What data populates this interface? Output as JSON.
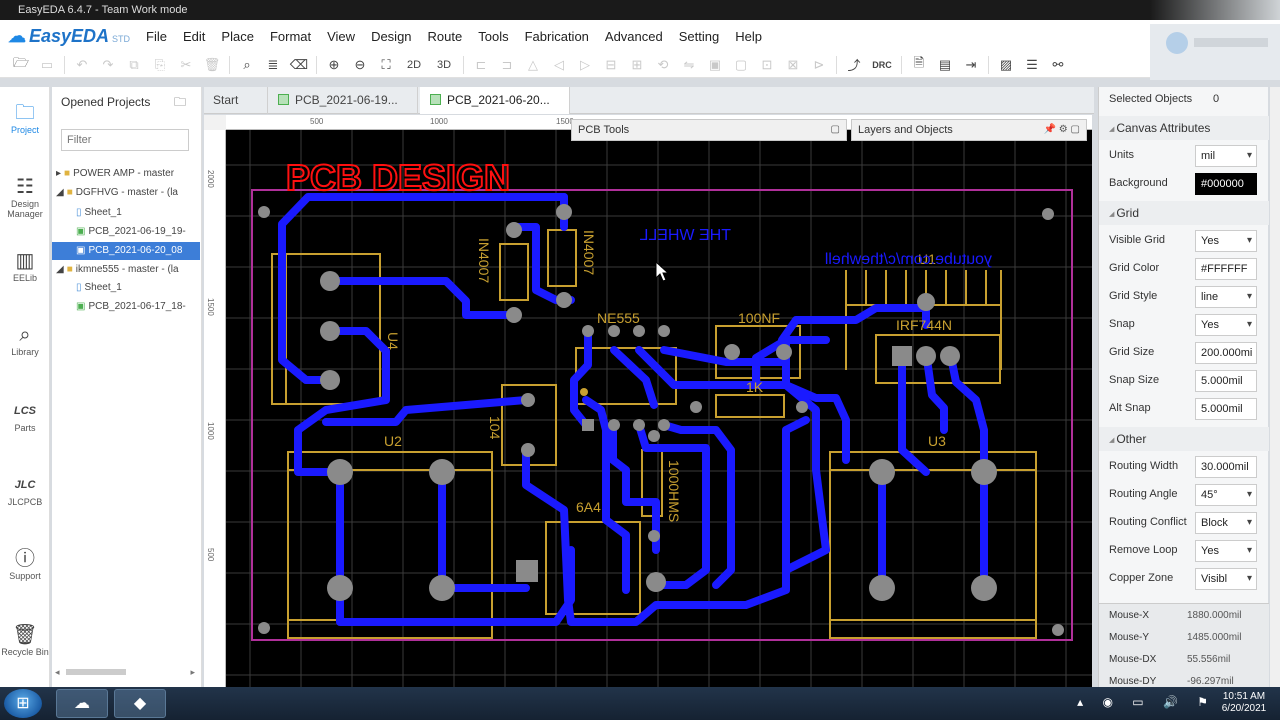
{
  "window": {
    "title": "EasyEDA 6.4.7 - Team Work mode"
  },
  "app": {
    "logo": "EasyEDA",
    "edition": "STD"
  },
  "menu": [
    "File",
    "Edit",
    "Place",
    "Format",
    "View",
    "Design",
    "Route",
    "Tools",
    "Fabrication",
    "Advanced",
    "Setting",
    "Help"
  ],
  "toolbar": {
    "view2d": "2D",
    "view3d": "3D",
    "drc": "DRC"
  },
  "leftbar": [
    {
      "label": "Project",
      "icon": "folder-icon"
    },
    {
      "label": "Design Manager",
      "icon": "list-icon"
    },
    {
      "label": "EELib",
      "icon": "chip-icon"
    },
    {
      "label": "Library",
      "icon": "search-library-icon"
    },
    {
      "label": "Parts",
      "icon": "lcsc-icon"
    },
    {
      "label": "JLCPCB",
      "icon": "jlc-icon"
    },
    {
      "label": "Support",
      "icon": "help-icon"
    },
    {
      "label": "Recycle Bin",
      "icon": "trash-icon"
    }
  ],
  "projects": {
    "title": "Opened Projects",
    "filter_placeholder": "Filter",
    "items": [
      {
        "label": "POWER AMP - master",
        "type": "folder",
        "indent": 0
      },
      {
        "label": "DGFHVG - master - (la",
        "type": "folder",
        "indent": 0
      },
      {
        "label": "Sheet_1",
        "type": "sheet",
        "indent": 1
      },
      {
        "label": "PCB_2021-06-19_19-",
        "type": "pcb",
        "indent": 1
      },
      {
        "label": "PCB_2021-06-20_08",
        "type": "pcb",
        "indent": 1,
        "selected": true
      },
      {
        "label": "ikmne555 - master - (la",
        "type": "folder",
        "indent": 0
      },
      {
        "label": "Sheet_1",
        "type": "sheet",
        "indent": 1
      },
      {
        "label": "PCB_2021-06-17_18-",
        "type": "pcb",
        "indent": 1
      }
    ]
  },
  "tabs": [
    {
      "label": "Start"
    },
    {
      "label": "PCB_2021-06-19..."
    },
    {
      "label": "PCB_2021-06-20..."
    }
  ],
  "rulers": {
    "top": [
      "500",
      "1000",
      "1500"
    ],
    "left": [
      "2000",
      "1500",
      "1000",
      "500"
    ]
  },
  "floating": {
    "pcb_tools": "PCB Tools",
    "layers": "Layers and Objects"
  },
  "board": {
    "title": "PCB DESIGN",
    "labels": {
      "in4007a": "IN4007",
      "in4007b": "IN4007",
      "thewheel": "THE WHELL",
      "youtube": "youtube.com/c/thewhell",
      "u1": "U1",
      "ne555": "NE555",
      "c100nf": "100NF",
      "irf": "IRF744N",
      "r1k": "1K",
      "u4": "U4",
      "c104": "104",
      "u2": "U2",
      "u3": "U3",
      "f6a4": "6A4",
      "smd": "1000HMS"
    }
  },
  "properties": {
    "selected_label": "Selected Objects",
    "selected_count": "0",
    "sections": {
      "canvas": "Canvas Attributes",
      "grid": "Grid",
      "other": "Other"
    },
    "canvas": [
      {
        "label": "Units",
        "value": "mil",
        "select": true
      },
      {
        "label": "Background",
        "value": "#000000",
        "select": false
      }
    ],
    "grid": [
      {
        "label": "Visible Grid",
        "value": "Yes",
        "select": true
      },
      {
        "label": "Grid Color",
        "value": "#FFFFFF",
        "select": false
      },
      {
        "label": "Grid Style",
        "value": "line",
        "select": true
      },
      {
        "label": "Snap",
        "value": "Yes",
        "select": true
      },
      {
        "label": "Grid Size",
        "value": "200.000mi",
        "select": false
      },
      {
        "label": "Snap Size",
        "value": "5.000mil",
        "select": false
      },
      {
        "label": "Alt Snap",
        "value": "5.000mil",
        "select": false
      }
    ],
    "other": [
      {
        "label": "Routing Width",
        "value": "30.000mil",
        "select": false
      },
      {
        "label": "Routing Angle",
        "value": "45°",
        "select": true
      },
      {
        "label": "Routing Conflict",
        "value": "Block",
        "select": true
      },
      {
        "label": "Remove Loop",
        "value": "Yes",
        "select": true
      },
      {
        "label": "Copper Zone",
        "value": "Visibl",
        "select": true
      }
    ],
    "mouse": [
      {
        "label": "Mouse-X",
        "value": "1880.000mil"
      },
      {
        "label": "Mouse-Y",
        "value": "1485.000mil"
      },
      {
        "label": "Mouse-DX",
        "value": "55.556mil"
      },
      {
        "label": "Mouse-DY",
        "value": "-96.297mil"
      }
    ]
  },
  "taskbar": {
    "time": "10:51 AM",
    "date": "6/20/2021"
  },
  "colors": {
    "trace": "#1a1aff",
    "silk": "#c8a030",
    "outline": "#b0309a",
    "title": "#ff1010",
    "board_bg": "#000000",
    "accent": "#3d7ed8"
  }
}
